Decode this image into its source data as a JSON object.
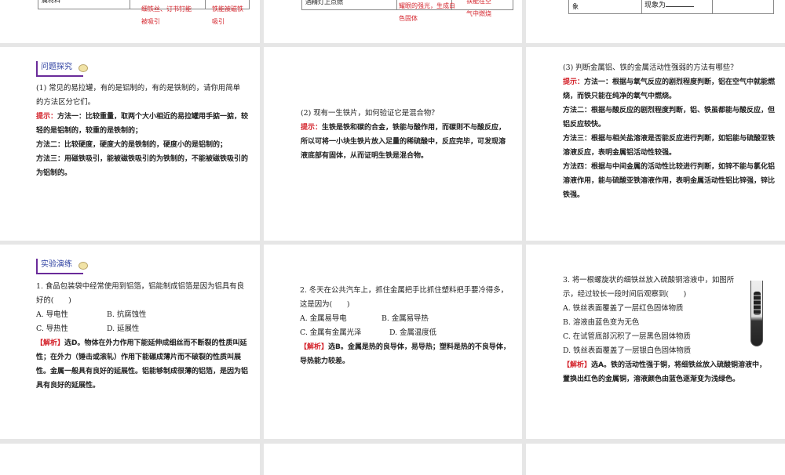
{
  "top_row": {
    "s1": {
      "cell": "属材料",
      "red1": "细铁丝、订书钉能被吸引",
      "red2": "铁能被磁铁吸引"
    },
    "s2": {
      "cell": "酒精灯上点燃",
      "red1": "耀眼的强光，生成白色固体",
      "red2": "铁能在空气中燃烧"
    },
    "s3": {
      "cell": "象",
      "cell2": "现象为"
    }
  },
  "slide4": {
    "header": "问题探究",
    "q": "(1) 常见的易拉罐，有的是铝制的，有的是铁制的，请你用简单的方法区分它们。",
    "hint_label": "提示：",
    "m1": "方法一：比较重量，取两个大小相近的易拉罐用手掂一掂，较轻的是铝制的，较重的是铁制的；",
    "m2": "方法二：比较硬度，硬度大的是铁制的，硬度小的是铝制的；",
    "m3": "方法三：用磁铁吸引，能被磁铁吸引的为铁制的，不能被磁铁吸引的为铝制的。"
  },
  "slide5": {
    "q": "(2) 现有一生铁片，如何验证它是混合物？",
    "hint_label": "提示：",
    "hint": "生铁是铁和碳的合金，铁能与酸作用，而碳则不与酸反应，所以可将一小块生铁片放入足量的稀硫酸中，反应完毕，可发现溶液底部有固体，从而证明生铁是混合物。"
  },
  "slide6": {
    "q": "(3) 判断金属铝、铁的金属活动性强弱的方法有哪些？",
    "hint_label": "提示：",
    "m1": "方法一：根据与氧气反应的剧烈程度判断，铝在空气中就能燃烧，而铁只能在纯净的氧气中燃烧。",
    "m2": "方法二：根据与酸反应的剧烈程度判断，铝、铁虽都能与酸反应，但铝反应较快。",
    "m3": "方法三：根据与相关盐溶液是否能反应进行判断，如铝能与硫酸亚铁溶液反应，表明金属铝活动性较强。",
    "m4": "方法四：根据与中间金属的活动性比较进行判断，如锌不能与氯化铝溶液作用，能与硫酸亚铁溶液作用，表明金属活动性铝比锌强，锌比铁强。"
  },
  "slide7": {
    "header": "实验演练",
    "q": "1. 食品包装袋中经常使用到铝箔，铝能制成铝箔是因为铝具有良好的(　　)",
    "a": "A. 导电性",
    "b": "B. 抗腐蚀性",
    "c": "C. 导热性",
    "d": "D. 延展性",
    "ans_label": "【解析】",
    "ans": "选D。物体在外力作用下能延伸成细丝而不断裂的性质叫延性；在外力（锤击或滚轧）作用下能碾成薄片而不破裂的性质叫展性。金属一般具有良好的延展性。铝能够制成很薄的铝箔，是因为铝具有良好的延展性。"
  },
  "slide8": {
    "q": "2. 冬天在公共汽车上，抓住金属把手比抓住塑料把手要冷得多，这是因为(　　)",
    "a": "A. 金属易导电",
    "b": "B. 金属易导热",
    "c": "C. 金属有金属光泽",
    "d": "D. 金属温度低",
    "ans_label": "【解析】",
    "ans": "选B。金属是热的良导体，易导热；塑料是热的不良导体，导热能力较差。"
  },
  "slide9": {
    "q": "3. 将一根螺旋状的细铁丝放入硫酸铜溶液中，如图所示，经过较长一段时间后观察到(　　)",
    "a": "A. 铁丝表面覆盖了一层红色固体物质",
    "b": "B. 溶液由蓝色变为无色",
    "c": "C. 在试管底部沉积了一层黑色固体物质",
    "d": "D. 铁丝表面覆盖了一层银白色固体物质",
    "ans_label": "【解析】",
    "ans": "选A。铁的活动性强于铜，将细铁丝放入硫酸铜溶液中，置换出红色的金属铜，溶液颜色由蓝色逐渐变为浅绿色。"
  }
}
